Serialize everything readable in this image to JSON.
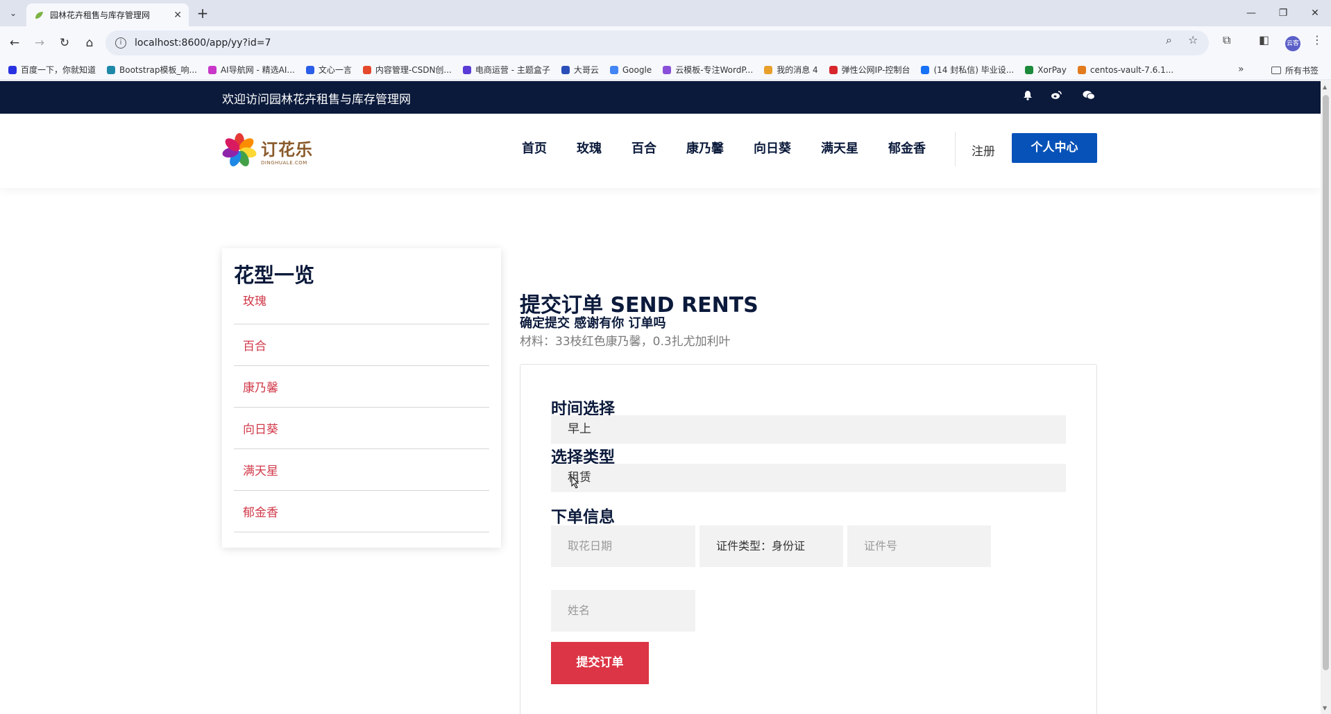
{
  "browser": {
    "tab_title": "园林花卉租售与库存管理网",
    "tab_close": "✕",
    "new_tab": "+",
    "url": "localhost:8600/app/yy?id=7",
    "bookmarks": [
      {
        "label": "百度一下，你就知道",
        "color": "#2932e1"
      },
      {
        "label": "Bootstrap模板_响...",
        "color": "#1e88a8"
      },
      {
        "label": "AI导航网 - 精选AI...",
        "color": "#c837c8"
      },
      {
        "label": "文心一言",
        "color": "#2a5ee8"
      },
      {
        "label": "内容管理-CSDN创...",
        "color": "#e5492c"
      },
      {
        "label": "电商运营 - 主题盒子",
        "color": "#5b3bd6"
      },
      {
        "label": "大哥云",
        "color": "#2a4fb8"
      },
      {
        "label": "Google",
        "color": "#4285f4"
      },
      {
        "label": "云模板-专注WordP...",
        "color": "#8a4fd8"
      },
      {
        "label": "我的消息 4",
        "color": "#e8a02a"
      },
      {
        "label": "弹性公网IP-控制台",
        "color": "#d8262e"
      },
      {
        "label": "(14 封私信) 毕业设...",
        "color": "#1772f6"
      },
      {
        "label": "XorPay",
        "color": "#1b8a3a"
      },
      {
        "label": "centos-vault-7.6.1...",
        "color": "#e27a1e"
      }
    ],
    "bookmarks_more": "»",
    "all_bookmarks": "所有书签",
    "profile_initials": "云客"
  },
  "topbar": {
    "welcome": "欢迎访问园林花卉租售与库存管理网",
    "icons": [
      "bell-icon",
      "weibo-icon",
      "wechat-icon"
    ]
  },
  "header": {
    "logo_cn": "订花乐",
    "logo_en": "DINGHUALE.COM",
    "nav": [
      "首页",
      "玫瑰",
      "百合",
      "康乃馨",
      "向日葵",
      "满天星",
      "郁金香"
    ],
    "register": "注册",
    "profile_button": "个人中心"
  },
  "sidebar": {
    "title": "花型一览",
    "items": [
      "玫瑰",
      "百合",
      "康乃馨",
      "向日葵",
      "满天星",
      "郁金香"
    ]
  },
  "main": {
    "heading": "提交订单 SEND RENTS",
    "subheading": "确定提交 感谢有你 订单吗",
    "material": "材料：33枝红色康乃馨，0.3扎尤加利叶"
  },
  "form": {
    "time_label": "时间选择",
    "time_value": "早上",
    "type_label": "选择类型",
    "type_value": "租赁",
    "order_info_label": "下单信息",
    "pickup_date_placeholder": "取花日期",
    "id_type_value": "证件类型：身份证",
    "id_number_placeholder": "证件号",
    "name_placeholder": "姓名",
    "submit_label": "提交订单"
  },
  "colors": {
    "navy": "#0b1a3b",
    "accent_blue": "#0652b8",
    "submit_red": "#dc3545",
    "link_red": "#d03a4a"
  }
}
